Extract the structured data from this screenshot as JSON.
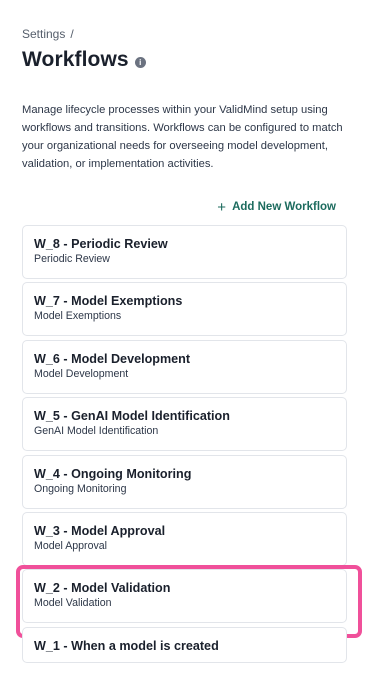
{
  "breadcrumb": {
    "root": "Settings",
    "separator": "/"
  },
  "header": {
    "title": "Workflows",
    "info_icon": "i"
  },
  "description": "Manage lifecycle processes within your ValidMind setup using workflows and transitions. Workflows can be configured to match your organizational needs for overseeing model development, validation, or implementation activities.",
  "actions": {
    "add_label": "Add New Workflow",
    "add_icon": "+"
  },
  "colors": {
    "accent": "#1c6b5e",
    "highlight": "#f0509a"
  },
  "workflows": [
    {
      "title": "W_8 - Periodic Review",
      "subtitle": "Periodic Review"
    },
    {
      "title": "W_7 - Model Exemptions",
      "subtitle": "Model Exemptions"
    },
    {
      "title": "W_6 - Model Development",
      "subtitle": "Model Development"
    },
    {
      "title": "W_5 - GenAI Model Identification",
      "subtitle": "GenAI Model Identification"
    },
    {
      "title": "W_4 - Ongoing Monitoring",
      "subtitle": "Ongoing Monitoring"
    },
    {
      "title": "W_3 - Model Approval",
      "subtitle": "Model Approval"
    },
    {
      "title": "W_2 - Model Validation",
      "subtitle": "Model Validation"
    },
    {
      "title": "W_1 - When a model is created",
      "subtitle": ""
    }
  ]
}
